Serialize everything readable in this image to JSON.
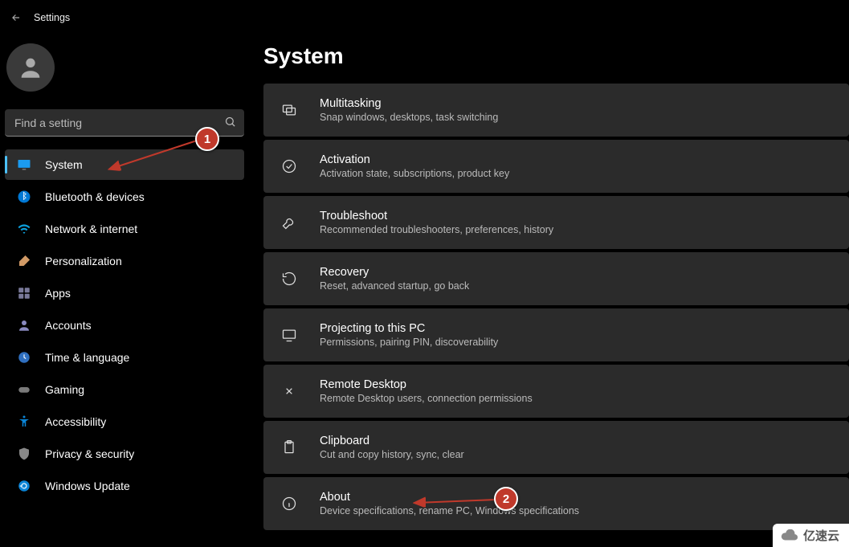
{
  "app_title": "Settings",
  "profile": {
    "initial": "",
    "name": "",
    "sub": ""
  },
  "search": {
    "placeholder": "Find a setting"
  },
  "sidebar": {
    "items": [
      {
        "label": "System",
        "icon": "monitor-icon",
        "active": true
      },
      {
        "label": "Bluetooth & devices",
        "icon": "bluetooth-icon",
        "active": false
      },
      {
        "label": "Network & internet",
        "icon": "wifi-icon",
        "active": false
      },
      {
        "label": "Personalization",
        "icon": "brush-icon",
        "active": false
      },
      {
        "label": "Apps",
        "icon": "apps-icon",
        "active": false
      },
      {
        "label": "Accounts",
        "icon": "person-icon",
        "active": false
      },
      {
        "label": "Time & language",
        "icon": "clock-icon",
        "active": false
      },
      {
        "label": "Gaming",
        "icon": "gamepad-icon",
        "active": false
      },
      {
        "label": "Accessibility",
        "icon": "accessibility-icon",
        "active": false
      },
      {
        "label": "Privacy & security",
        "icon": "shield-icon",
        "active": false
      },
      {
        "label": "Windows Update",
        "icon": "update-icon",
        "active": false
      }
    ]
  },
  "page": {
    "title": "System",
    "cards": [
      {
        "title": "Multitasking",
        "sub": "Snap windows, desktops, task switching",
        "icon": "multitask-icon"
      },
      {
        "title": "Activation",
        "sub": "Activation state, subscriptions, product key",
        "icon": "check-circle-icon"
      },
      {
        "title": "Troubleshoot",
        "sub": "Recommended troubleshooters, preferences, history",
        "icon": "wrench-icon"
      },
      {
        "title": "Recovery",
        "sub": "Reset, advanced startup, go back",
        "icon": "recovery-icon"
      },
      {
        "title": "Projecting to this PC",
        "sub": "Permissions, pairing PIN, discoverability",
        "icon": "project-icon"
      },
      {
        "title": "Remote Desktop",
        "sub": "Remote Desktop users, connection permissions",
        "icon": "remote-icon"
      },
      {
        "title": "Clipboard",
        "sub": "Cut and copy history, sync, clear",
        "icon": "clipboard-icon"
      },
      {
        "title": "About",
        "sub": "Device specifications, rename PC, Windows specifications",
        "icon": "info-icon"
      }
    ]
  },
  "annotations": {
    "badge1": "1",
    "badge2": "2"
  },
  "watermark": "亿速云",
  "colors": {
    "accent": "#4cc2ff",
    "annotation": "#c0392b",
    "card_bg": "#2b2b2b"
  }
}
